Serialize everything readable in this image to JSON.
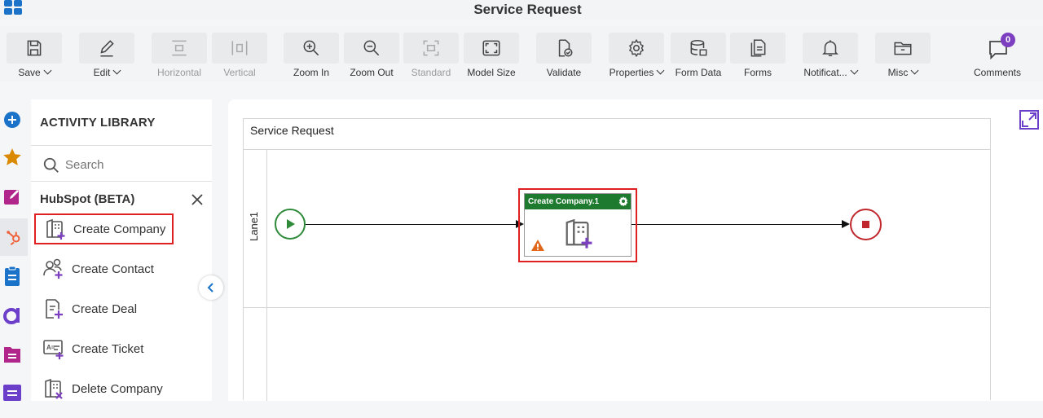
{
  "app": {
    "title": "Service Request"
  },
  "toolbar": {
    "items": [
      {
        "label": "Save",
        "icon": "save-icon",
        "dropdown": true,
        "disabled": false
      },
      {
        "label": "Edit",
        "icon": "edit-icon",
        "dropdown": true,
        "disabled": false
      },
      {
        "label": "Horizontal",
        "icon": "horizontal-icon",
        "dropdown": false,
        "disabled": true
      },
      {
        "label": "Vertical",
        "icon": "vertical-icon",
        "dropdown": false,
        "disabled": true
      },
      {
        "label": "Zoom In",
        "icon": "zoom-in-icon",
        "dropdown": false,
        "disabled": false
      },
      {
        "label": "Zoom Out",
        "icon": "zoom-out-icon",
        "dropdown": false,
        "disabled": false
      },
      {
        "label": "Standard",
        "icon": "standard-icon",
        "dropdown": false,
        "disabled": true
      },
      {
        "label": "Model Size",
        "icon": "model-size-icon",
        "dropdown": false,
        "disabled": false
      },
      {
        "label": "Validate",
        "icon": "validate-icon",
        "dropdown": false,
        "disabled": false
      },
      {
        "label": "Properties",
        "icon": "gear-icon",
        "dropdown": true,
        "disabled": false
      },
      {
        "label": "Form Data",
        "icon": "database-icon",
        "dropdown": false,
        "disabled": false
      },
      {
        "label": "Forms",
        "icon": "forms-icon",
        "dropdown": false,
        "disabled": false
      },
      {
        "label": "Notificat...",
        "icon": "bell-icon",
        "dropdown": true,
        "disabled": false
      },
      {
        "label": "Misc",
        "icon": "folder-icon",
        "dropdown": true,
        "disabled": false
      }
    ],
    "comments": {
      "label": "Comments",
      "count": "0"
    }
  },
  "library": {
    "title": "ACTIVITY LIBRARY",
    "search_placeholder": "Search",
    "group": "HubSpot (BETA)",
    "activities": [
      {
        "label": "Create Company",
        "selected": true
      },
      {
        "label": "Create Contact",
        "selected": false
      },
      {
        "label": "Create Deal",
        "selected": false
      },
      {
        "label": "Create Ticket",
        "selected": false
      },
      {
        "label": "Delete Company",
        "selected": false
      }
    ]
  },
  "canvas": {
    "pool_title": "Service Request",
    "lane_label": "Lane1",
    "task_title": "Create Company.1"
  },
  "colors": {
    "accent": "#1a73c8",
    "purple": "#7b3fc0",
    "task_header": "#1e7a2e",
    "start": "#2e8b3a",
    "end": "#c0282d",
    "highlight": "#e02020",
    "warning": "#e0661a"
  }
}
